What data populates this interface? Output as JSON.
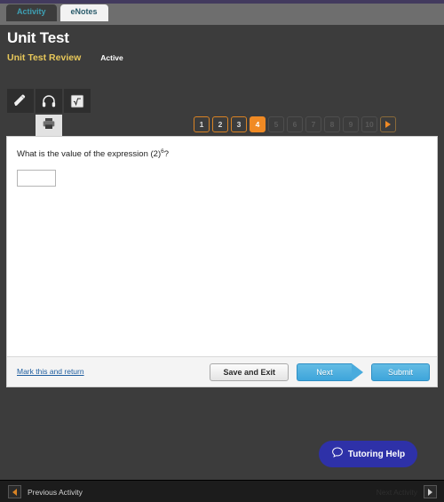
{
  "window": {
    "top_strip_color": "#423a5e",
    "tab_band_color": "#6e6e6e",
    "body_color": "#3c3c3c"
  },
  "tabs": [
    {
      "label": "Activity",
      "state": "active"
    },
    {
      "label": "eNotes",
      "state": "inactive"
    }
  ],
  "header": {
    "title": "Unit Test",
    "subtitle": "Unit Test Review",
    "status": "Active",
    "subtitle_color": "#e8c85a"
  },
  "toolbar": {
    "items": [
      {
        "icon": "highlighter-icon",
        "label": "Highlighter"
      },
      {
        "icon": "headphones-icon",
        "label": "Read Aloud"
      },
      {
        "icon": "equation-editor-icon",
        "label": "Equation Editor"
      }
    ],
    "print": {
      "icon": "printer-icon",
      "label": "Print"
    }
  },
  "question_nav": {
    "buttons": [
      {
        "label": "1",
        "state": "visited"
      },
      {
        "label": "2",
        "state": "visited"
      },
      {
        "label": "3",
        "state": "visited"
      },
      {
        "label": "4",
        "state": "current"
      },
      {
        "label": "5",
        "state": "disabled"
      },
      {
        "label": "6",
        "state": "disabled"
      },
      {
        "label": "7",
        "state": "disabled"
      },
      {
        "label": "8",
        "state": "disabled"
      },
      {
        "label": "9",
        "state": "disabled"
      },
      {
        "label": "10",
        "state": "disabled"
      }
    ],
    "next_arrow": {
      "icon": "chevron-right-icon",
      "state": "enabled"
    },
    "current_color": "#f08a24",
    "visited_border_color": "#d98324"
  },
  "question": {
    "prompt_before": "What is the value of the expression (2)",
    "exponent": "6",
    "prompt_after": "?",
    "answer_value": "",
    "answer_placeholder": ""
  },
  "actions": {
    "mark_link": "Mark this and return",
    "save_label": "Save and Exit",
    "next_label": "Next",
    "submit_label": "Submit",
    "primary_color": "#3ea5db"
  },
  "tutoring": {
    "label": "Tutoring Help",
    "icon": "chat-bubble-icon",
    "color": "#2e31a8"
  },
  "bottom_bar": {
    "previous_label": "Previous Activity",
    "previous_icon": "arrow-left-icon",
    "next_label": "Next Activity",
    "next_icon": "arrow-right-icon",
    "next_state": "disabled"
  }
}
